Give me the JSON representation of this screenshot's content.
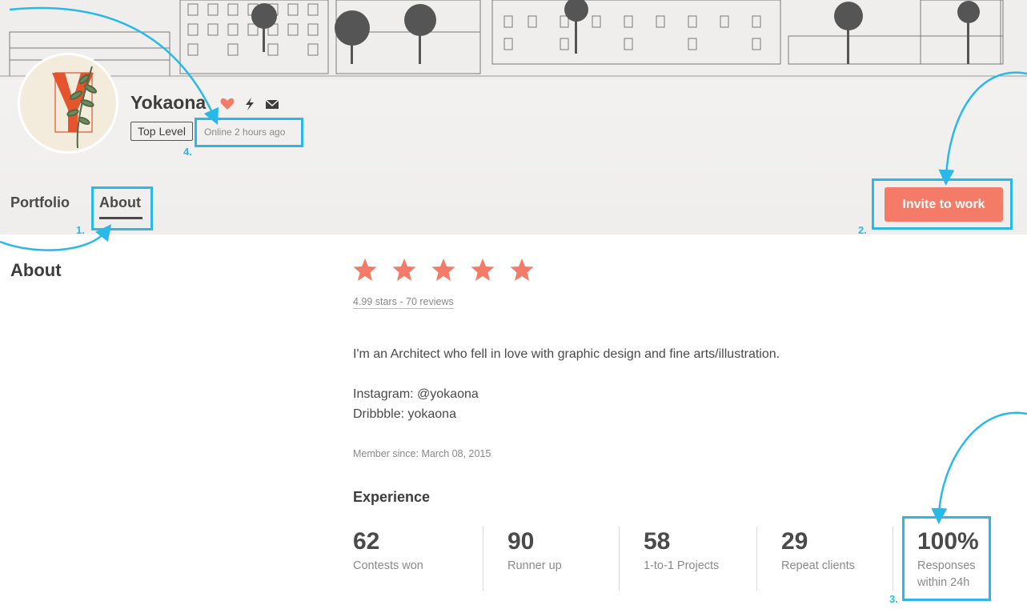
{
  "profile": {
    "name": "Yokaona",
    "level_badge": "Top Level",
    "online_status": "Online 2 hours ago",
    "icons": [
      "heart-icon",
      "bolt-icon",
      "mail-icon"
    ]
  },
  "tabs": [
    {
      "label": "Portfolio",
      "active": false
    },
    {
      "label": "About",
      "active": true
    }
  ],
  "invite_button": {
    "label": "Invite to work"
  },
  "about": {
    "heading": "About",
    "rating": {
      "stars": 5,
      "text": "4.99 stars - 70 reviews"
    },
    "bio": [
      "I'm an Architect who fell in love with graphic design and fine arts/illustration.",
      "",
      "Instagram: @yokaona",
      "Dribbble: yokaona"
    ],
    "member_since": "Member since: March 08, 2015"
  },
  "experience": {
    "heading": "Experience",
    "stats": [
      {
        "value": "62",
        "label": "Contests won"
      },
      {
        "value": "90",
        "label": "Runner up"
      },
      {
        "value": "58",
        "label": "1-to-1 Projects"
      },
      {
        "value": "29",
        "label": "Repeat clients"
      },
      {
        "value": "100%",
        "label_line1": "Responses",
        "label_line2": "within 24h"
      }
    ]
  },
  "callouts": [
    "1.",
    "2.",
    "3.",
    "4."
  ],
  "colors": {
    "accent": "#f47b67",
    "callout": "#29b9e8",
    "text": "#4a4a4a",
    "muted": "#8a8a8a"
  }
}
